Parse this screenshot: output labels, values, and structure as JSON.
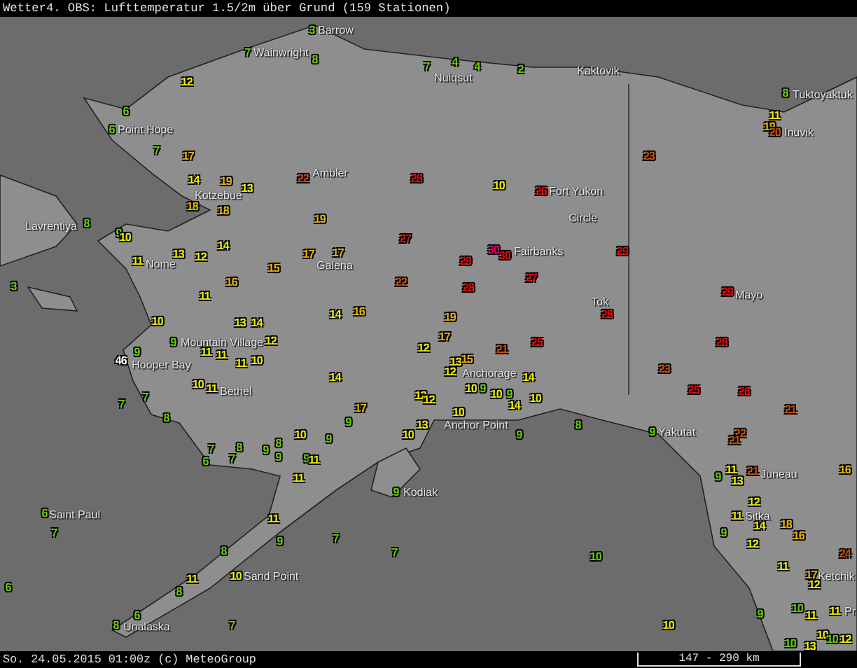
{
  "title": "Wetter4. OBS: Lufttemperatur 1.5/2m über Grund (159 Stationen)",
  "places": [
    "Barrow",
    "Wainwright",
    "Nuiqsut",
    "Kaktovik",
    "Tuktoyaktuk",
    "Inuvik",
    "Point Hope",
    "Kotzebue",
    "Ambler",
    "Fort Yukon",
    "Circle",
    "Lavrentiya",
    "Nome",
    "Galena",
    "Fairbanks",
    "Tok",
    "Mayo",
    "Mountain Village",
    "Hooper Bay",
    "Bethel",
    "Anchorage",
    "Anchor Point",
    "Yakutat",
    "Juneau",
    "Sitka",
    "Kodiak",
    "Saint Paul",
    "Sand Point",
    "Unalaska",
    "Ketchik",
    "Pr"
  ],
  "stations": [
    {
      "value": "7",
      "color": "#66cc00"
    },
    {
      "value": "12",
      "color": "#f0f000"
    },
    {
      "value": "6",
      "color": "#66cc00"
    },
    {
      "value": "6",
      "color": "#66cc00"
    },
    {
      "value": "7",
      "color": "#66cc00"
    },
    {
      "value": "17",
      "color": "#e8b400"
    },
    {
      "value": "14",
      "color": "#f0f000"
    },
    {
      "value": "19",
      "color": "#e8b400"
    },
    {
      "value": "13",
      "color": "#f0f000"
    },
    {
      "value": "18",
      "color": "#e8b400"
    },
    {
      "value": "18",
      "color": "#e8b400"
    },
    {
      "value": "8",
      "color": "#66cc00"
    },
    {
      "value": "9",
      "color": "#66cc00"
    },
    {
      "value": "10",
      "color": "#f0f000"
    },
    {
      "value": "11",
      "color": "#f0f000"
    },
    {
      "value": "13",
      "color": "#f0f000"
    },
    {
      "value": "12",
      "color": "#f0f000"
    },
    {
      "value": "14",
      "color": "#f0f000"
    },
    {
      "value": "15",
      "color": "#e8b400"
    },
    {
      "value": "16",
      "color": "#e8b400"
    },
    {
      "value": "11",
      "color": "#f0f000"
    },
    {
      "value": "3",
      "color": "#66cc00"
    },
    {
      "value": "10",
      "color": "#f0f000"
    },
    {
      "value": "13",
      "color": "#f0f000"
    },
    {
      "value": "14",
      "color": "#f0f000"
    },
    {
      "value": "3",
      "color": "#66cc00"
    },
    {
      "value": "8",
      "color": "#66cc00"
    },
    {
      "value": "7",
      "color": "#66cc00"
    },
    {
      "value": "4",
      "color": "#66cc00"
    },
    {
      "value": "4",
      "color": "#66cc00"
    },
    {
      "value": "2",
      "color": "#66cc00"
    },
    {
      "value": "22",
      "color": "#c84a00"
    },
    {
      "value": "28",
      "color": "#e80000"
    },
    {
      "value": "10",
      "color": "#f0f000"
    },
    {
      "value": "26",
      "color": "#e80000"
    },
    {
      "value": "19",
      "color": "#e8b400"
    },
    {
      "value": "27",
      "color": "#e80000"
    },
    {
      "value": "17",
      "color": "#e8b400"
    },
    {
      "value": "17",
      "color": "#e8b400"
    },
    {
      "value": "30",
      "color": "#d8006c"
    },
    {
      "value": "30",
      "color": "#e80000"
    },
    {
      "value": "29",
      "color": "#e80000"
    },
    {
      "value": "22",
      "color": "#c84a00"
    },
    {
      "value": "28",
      "color": "#e80000"
    },
    {
      "value": "27",
      "color": "#e80000"
    },
    {
      "value": "14",
      "color": "#f0f000"
    },
    {
      "value": "16",
      "color": "#e8b400"
    },
    {
      "value": "19",
      "color": "#e8b400"
    },
    {
      "value": "8",
      "color": "#66cc00"
    },
    {
      "value": "11",
      "color": "#f0f000"
    },
    {
      "value": "19",
      "color": "#e8b400"
    },
    {
      "value": "20",
      "color": "#c84a00"
    },
    {
      "value": "23",
      "color": "#c84a00"
    },
    {
      "value": "29",
      "color": "#e80000"
    },
    {
      "value": "29",
      "color": "#e80000"
    },
    {
      "value": "28",
      "color": "#e80000"
    },
    {
      "value": "9",
      "color": "#66cc00"
    },
    {
      "value": "12",
      "color": "#f0f000"
    },
    {
      "value": "9",
      "color": "#66cc00"
    },
    {
      "value": "46",
      "color": "#ffffff"
    },
    {
      "value": "11",
      "color": "#f0f000"
    },
    {
      "value": "11",
      "color": "#f0f000"
    },
    {
      "value": "11",
      "color": "#f0f000"
    },
    {
      "value": "10",
      "color": "#f0f000"
    },
    {
      "value": "10",
      "color": "#f0f000"
    },
    {
      "value": "11",
      "color": "#f0f000"
    },
    {
      "value": "7",
      "color": "#66cc00"
    },
    {
      "value": "7",
      "color": "#66cc00"
    },
    {
      "value": "8",
      "color": "#66cc00"
    },
    {
      "value": "7",
      "color": "#66cc00"
    },
    {
      "value": "8",
      "color": "#66cc00"
    },
    {
      "value": "6",
      "color": "#66cc00"
    },
    {
      "value": "7",
      "color": "#66cc00"
    },
    {
      "value": "9",
      "color": "#66cc00"
    },
    {
      "value": "8",
      "color": "#66cc00"
    },
    {
      "value": "9",
      "color": "#66cc00"
    },
    {
      "value": "6",
      "color": "#66cc00"
    },
    {
      "value": "7",
      "color": "#66cc00"
    },
    {
      "value": "11",
      "color": "#f0f000"
    },
    {
      "value": "9",
      "color": "#66cc00"
    },
    {
      "value": "8",
      "color": "#66cc00"
    },
    {
      "value": "6",
      "color": "#66cc00"
    },
    {
      "value": "11",
      "color": "#f0f000"
    },
    {
      "value": "10",
      "color": "#f0f000"
    },
    {
      "value": "8",
      "color": "#66cc00"
    },
    {
      "value": "6",
      "color": "#66cc00"
    },
    {
      "value": "8",
      "color": "#66cc00"
    },
    {
      "value": "7",
      "color": "#66cc00"
    },
    {
      "value": "17",
      "color": "#e8b400"
    },
    {
      "value": "25",
      "color": "#e80000"
    },
    {
      "value": "12",
      "color": "#f0f000"
    },
    {
      "value": "21",
      "color": "#c84a00"
    },
    {
      "value": "13",
      "color": "#f0f000"
    },
    {
      "value": "15",
      "color": "#e8b400"
    },
    {
      "value": "14",
      "color": "#f0f000"
    },
    {
      "value": "12",
      "color": "#f0f000"
    },
    {
      "value": "14",
      "color": "#f0f000"
    },
    {
      "value": "12",
      "color": "#f0f000"
    },
    {
      "value": "12",
      "color": "#f0f000"
    },
    {
      "value": "10",
      "color": "#f0f000"
    },
    {
      "value": "9",
      "color": "#66cc00"
    },
    {
      "value": "10",
      "color": "#f0f000"
    },
    {
      "value": "9",
      "color": "#66cc00"
    },
    {
      "value": "10",
      "color": "#f0f000"
    },
    {
      "value": "17",
      "color": "#e8b400"
    },
    {
      "value": "14",
      "color": "#f0f000"
    },
    {
      "value": "9",
      "color": "#66cc00"
    },
    {
      "value": "10",
      "color": "#f0f000"
    },
    {
      "value": "10",
      "color": "#f0f000"
    },
    {
      "value": "9",
      "color": "#66cc00"
    },
    {
      "value": "13",
      "color": "#f0f000"
    },
    {
      "value": "10",
      "color": "#f0f000"
    },
    {
      "value": "9",
      "color": "#66cc00"
    },
    {
      "value": "9",
      "color": "#66cc00"
    },
    {
      "value": "11",
      "color": "#f0f000"
    },
    {
      "value": "11",
      "color": "#f0f000"
    },
    {
      "value": "9",
      "color": "#66cc00"
    },
    {
      "value": "7",
      "color": "#66cc00"
    },
    {
      "value": "7",
      "color": "#66cc00"
    },
    {
      "value": "28",
      "color": "#e80000"
    },
    {
      "value": "23",
      "color": "#c84a00"
    },
    {
      "value": "25",
      "color": "#e80000"
    },
    {
      "value": "26",
      "color": "#e80000"
    },
    {
      "value": "21",
      "color": "#c84a00"
    },
    {
      "value": "8",
      "color": "#66cc00"
    },
    {
      "value": "9",
      "color": "#66cc00"
    },
    {
      "value": "22",
      "color": "#c84a00"
    },
    {
      "value": "21",
      "color": "#c84a00"
    },
    {
      "value": "11",
      "color": "#f0f000"
    },
    {
      "value": "21",
      "color": "#c84a00"
    },
    {
      "value": "9",
      "color": "#66cc00"
    },
    {
      "value": "13",
      "color": "#f0f000"
    },
    {
      "value": "16",
      "color": "#e8b400"
    },
    {
      "value": "12",
      "color": "#f0f000"
    },
    {
      "value": "11",
      "color": "#f0f000"
    },
    {
      "value": "9",
      "color": "#66cc00"
    },
    {
      "value": "14",
      "color": "#f0f000"
    },
    {
      "value": "18",
      "color": "#e8b400"
    },
    {
      "value": "16",
      "color": "#e8b400"
    },
    {
      "value": "12",
      "color": "#f0f000"
    },
    {
      "value": "10",
      "color": "#66cc00"
    },
    {
      "value": "24",
      "color": "#c84a00"
    },
    {
      "value": "11",
      "color": "#f0f000"
    },
    {
      "value": "17",
      "color": "#e8b400"
    },
    {
      "value": "12",
      "color": "#f0f000"
    },
    {
      "value": "9",
      "color": "#66cc00"
    },
    {
      "value": "10",
      "color": "#66cc00"
    },
    {
      "value": "11",
      "color": "#f0f000"
    },
    {
      "value": "11",
      "color": "#f0f000"
    },
    {
      "value": "10",
      "color": "#f0f000"
    },
    {
      "value": "10",
      "color": "#66cc00"
    },
    {
      "value": "13",
      "color": "#f0f000"
    },
    {
      "value": "10",
      "color": "#f0f000"
    },
    {
      "value": "10",
      "color": "#66cc00"
    },
    {
      "value": "12",
      "color": "#f0f000"
    }
  ],
  "footer": {
    "timestamp": "So. 24.05.2015 01:00z (c) MeteoGroup",
    "scale": "147 - 290 km"
  }
}
